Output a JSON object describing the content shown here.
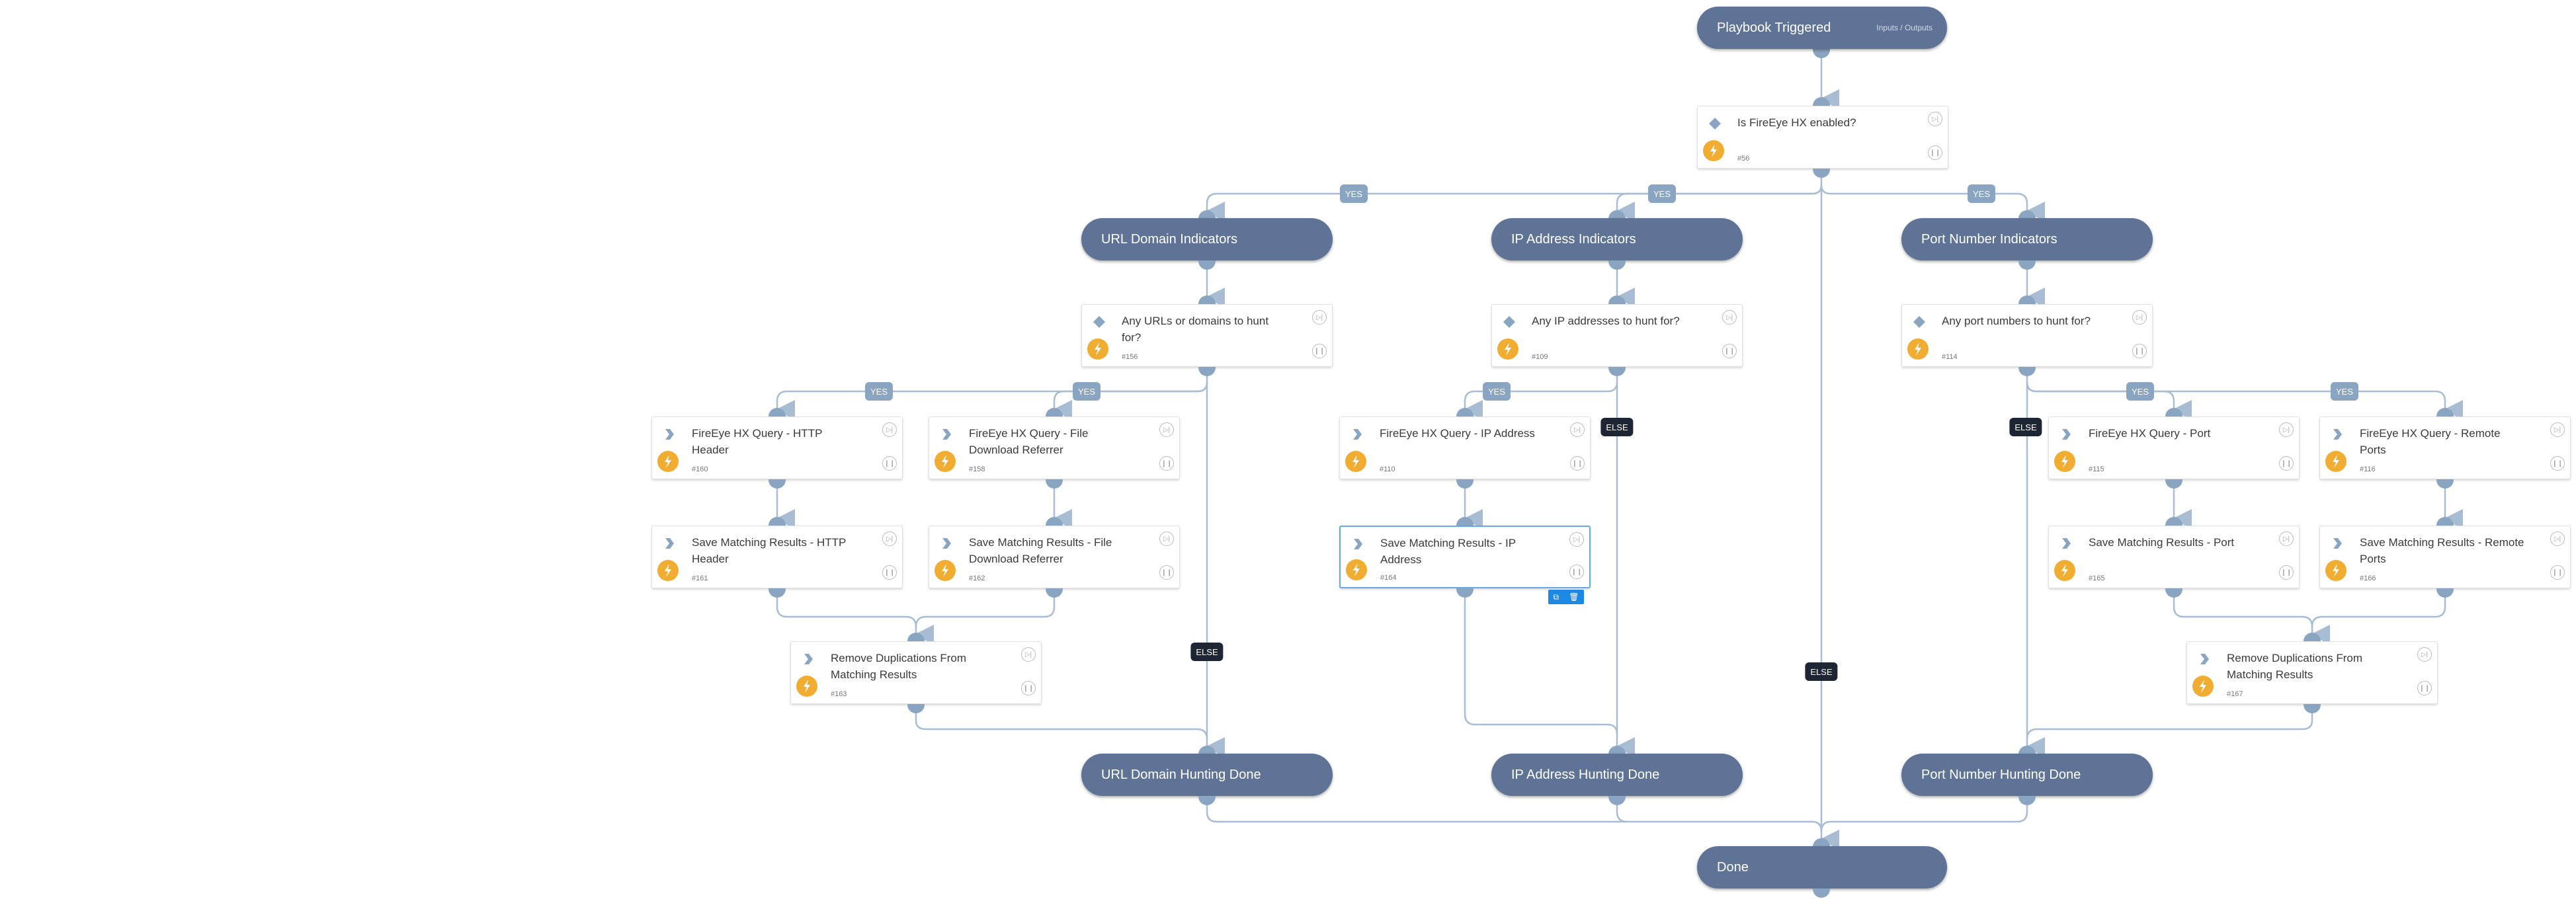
{
  "colors": {
    "pill": "#5f7396",
    "edge": "#a8bdd4",
    "port": "#8aa5c2",
    "yes_tag": "#8aa5c2",
    "else_tag": "#1e2636",
    "bolt": "#f0ad31",
    "selected_border": "#64a9e8",
    "toolbar": "#1e88e5"
  },
  "start": {
    "label": "Playbook Triggered",
    "sub_link": "Inputs / Outputs"
  },
  "condition_main": {
    "title": "Is FireEye HX enabled?",
    "id": "#56"
  },
  "sections": [
    {
      "label": "URL Domain Indicators"
    },
    {
      "label": "IP Address Indicators"
    },
    {
      "label": "Port Number Indicators"
    }
  ],
  "conditions": [
    {
      "title": "Any URLs or domains to hunt for?",
      "id": "#156"
    },
    {
      "title": "Any IP addresses to hunt for?",
      "id": "#109"
    },
    {
      "title": "Any port numbers to hunt for?",
      "id": "#114"
    }
  ],
  "tasks": [
    {
      "title": "FireEye HX Query - HTTP Header",
      "id": "#160"
    },
    {
      "title": "FireEye HX Query - File Download Referrer",
      "id": "#158"
    },
    {
      "title": "Save Matching Results - HTTP Header",
      "id": "#161"
    },
    {
      "title": "Save Matching Results - File Download Referrer",
      "id": "#162"
    },
    {
      "title": "Remove Duplications From Matching Results",
      "id": "#163"
    },
    {
      "title": "FireEye HX Query - IP Address",
      "id": "#110"
    },
    {
      "title": "Save Matching Results - IP Address",
      "id": "#164"
    },
    {
      "title": "FireEye HX Query - Port",
      "id": "#115"
    },
    {
      "title": "FireEye HX Query - Remote Ports",
      "id": "#116"
    },
    {
      "title": "Save Matching Results - Port",
      "id": "#165"
    },
    {
      "title": "Save Matching Results - Remote Ports",
      "id": "#166"
    },
    {
      "title": "Remove Duplications From Matching Results",
      "id": "#167"
    }
  ],
  "done_sections": [
    {
      "label": "URL Domain Hunting Done"
    },
    {
      "label": "IP Address Hunting Done"
    },
    {
      "label": "Port Number Hunting Done"
    }
  ],
  "end": {
    "label": "Done"
  },
  "branch_labels": {
    "yes": "YES",
    "else": "ELSE"
  },
  "selected_task_toolbar": {
    "copy_icon": "copy-icon",
    "delete_icon": "trash-icon"
  }
}
